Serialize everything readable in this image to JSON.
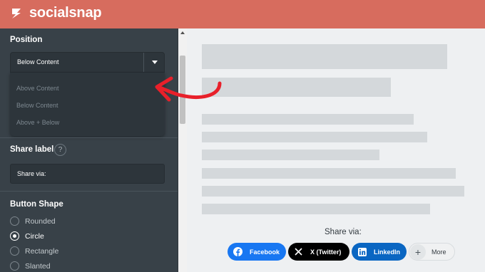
{
  "app": {
    "logo_text": "socialsnap",
    "logo_icon": "socialsnap-logo-icon",
    "brand_color": "#d76c5e"
  },
  "sidebar": {
    "position": {
      "label": "Position",
      "selected": "Below Content",
      "options": [
        "Above Content",
        "Below Content",
        "Above + Below"
      ]
    },
    "share_label": {
      "label": "Share label",
      "help": "?",
      "value": "Share via:"
    },
    "button_shape": {
      "label": "Button Shape",
      "options": [
        {
          "label": "Rounded",
          "checked": false
        },
        {
          "label": "Circle",
          "checked": true
        },
        {
          "label": "Rectangle",
          "checked": false
        },
        {
          "label": "Slanted",
          "checked": false
        }
      ]
    }
  },
  "preview": {
    "share_via": "Share via:",
    "buttons": [
      {
        "label": "Facebook",
        "icon": "facebook-icon",
        "color": "#1877f2"
      },
      {
        "label": "X (Twitter)",
        "icon": "x-icon",
        "color": "#000000"
      },
      {
        "label": "LinkedIn",
        "icon": "linkedin-icon",
        "color": "#0a66c2"
      },
      {
        "label": "More",
        "icon": "plus-icon",
        "color": "#f0f1f2"
      }
    ]
  },
  "annotation": {
    "arrow_color": "#e8202a"
  }
}
